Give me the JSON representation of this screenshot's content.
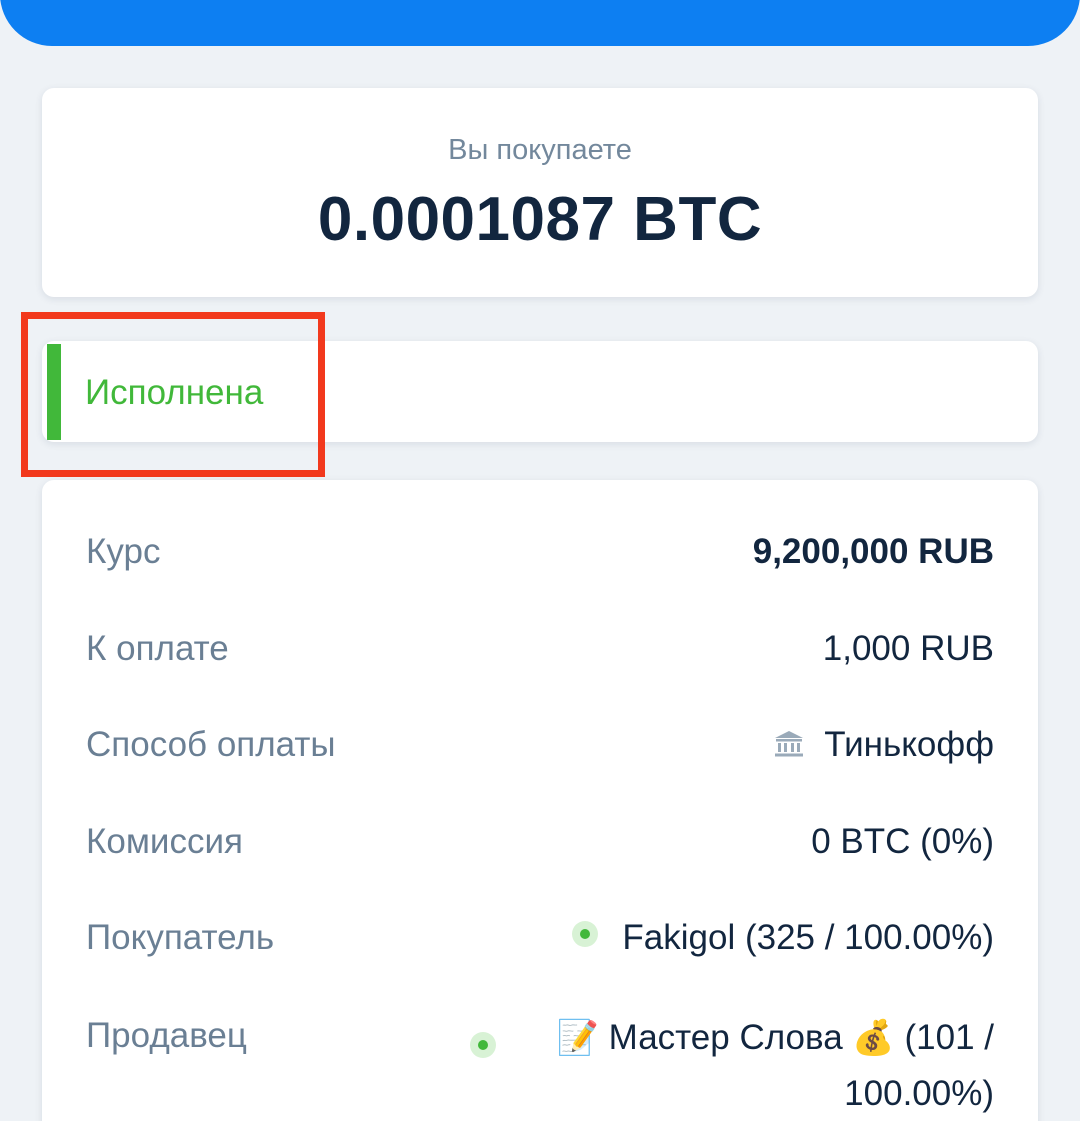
{
  "order": {
    "caption": "Вы покупаете",
    "amount": "0.0001087 BTC"
  },
  "status": {
    "label": "Исполнена",
    "color": "#41b83a"
  },
  "details": {
    "rate_label": "Курс",
    "rate_value": "9,200,000 RUB",
    "to_pay_label": "К оплате",
    "to_pay_value": "1,000 RUB",
    "payment_method_label": "Способ оплаты",
    "payment_method_icon": "bank-icon",
    "payment_method_value": "Тинькофф",
    "fee_label": "Комиссия",
    "fee_value": "0 BTC (0%)",
    "buyer_label": "Покупатель",
    "buyer_value": "Fakigol (325 / 100.00%)",
    "seller_label": "Продавец",
    "seller_emoji_prefix": "📝",
    "seller_name": "Мастер Слова",
    "seller_emoji_suffix": "💰",
    "seller_stats_line1": "(101 /",
    "seller_stats_line2": "100.00%)"
  },
  "colors": {
    "accent": "#0d7ff2",
    "highlight": "#f2391d",
    "success": "#41b83a",
    "text_dark": "#12263f",
    "text_muted": "#6a7f94"
  }
}
